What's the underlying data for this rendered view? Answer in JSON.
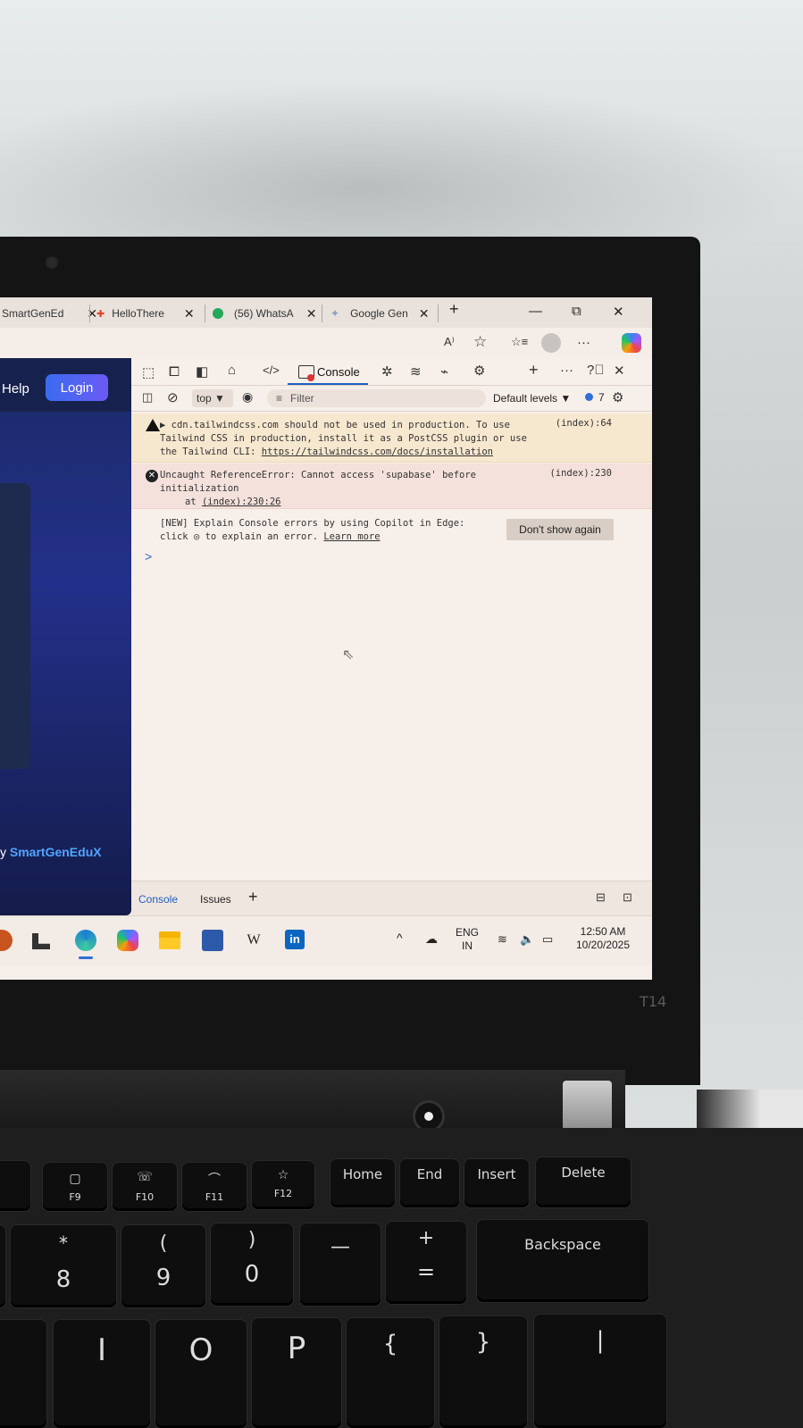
{
  "browser": {
    "tabs": [
      {
        "label": "SmartGenEd",
        "close": "✕"
      },
      {
        "label": "HelloThere",
        "close": "✕"
      },
      {
        "label": "(56) WhatsA",
        "close": "✕"
      },
      {
        "label": "Google Gen",
        "close": "✕"
      }
    ],
    "new_tab": "+",
    "window": {
      "minimize": "—",
      "restore": "⧉",
      "close": "✕"
    },
    "address_icons": {
      "read_aloud": "A⁾",
      "favorite": "☆",
      "favorites": "☆≡",
      "more": "···"
    }
  },
  "page": {
    "help_label": "Help",
    "login_label": "Login",
    "footer_prefix": "y ",
    "footer_brand": "SmartGenEduX"
  },
  "devtools": {
    "console_tab": "Console",
    "context": "top ▼",
    "filter_placeholder": "Filter",
    "levels": "Default levels ▼",
    "issues_count": "7",
    "messages": {
      "warning": {
        "text": "▶ cdn.tailwindcss.com should not be used in production. To use Tailwind CSS in production, install it as a PostCSS plugin or use the Tailwind CLI: ",
        "link": "https://tailwindcss.com/docs/installation",
        "source": "(index):64"
      },
      "error": {
        "text": "Uncaught ReferenceError: Cannot access 'supabase' before initialization",
        "at": "at ",
        "link": "(index):230:26",
        "source": "(index):230"
      },
      "info": {
        "line1": "[NEW] Explain Console errors by using Copilot in Edge:",
        "line2_prefix": "click ",
        "line2_mid": " to explain an error. ",
        "learn_more": "Learn more",
        "button": "Don't show again"
      }
    },
    "prompt": ">",
    "drawer_tabs": [
      "Console",
      "Issues"
    ],
    "drawer_add": "+"
  },
  "taskbar": {
    "lang": "ENG",
    "region": "IN",
    "time": "12:50 AM",
    "date": "10/20/2025",
    "chevron": "^"
  },
  "laptop": {
    "model": "T14"
  },
  "keyboard": {
    "row1": [
      "F9",
      "F10",
      "F11",
      "F12",
      "Home",
      "End",
      "Insert",
      "Delete"
    ],
    "row2": [
      {
        "top": "*",
        "main": "8"
      },
      {
        "top": "(",
        "main": "9"
      },
      {
        "top": ")",
        "main": "0"
      },
      {
        "top": "",
        "main": "—"
      },
      {
        "top": "+",
        "main": "="
      },
      {
        "top": "",
        "main": "Backspace"
      }
    ],
    "row3": [
      "I",
      "O",
      "P",
      "{",
      "}",
      "|"
    ]
  }
}
